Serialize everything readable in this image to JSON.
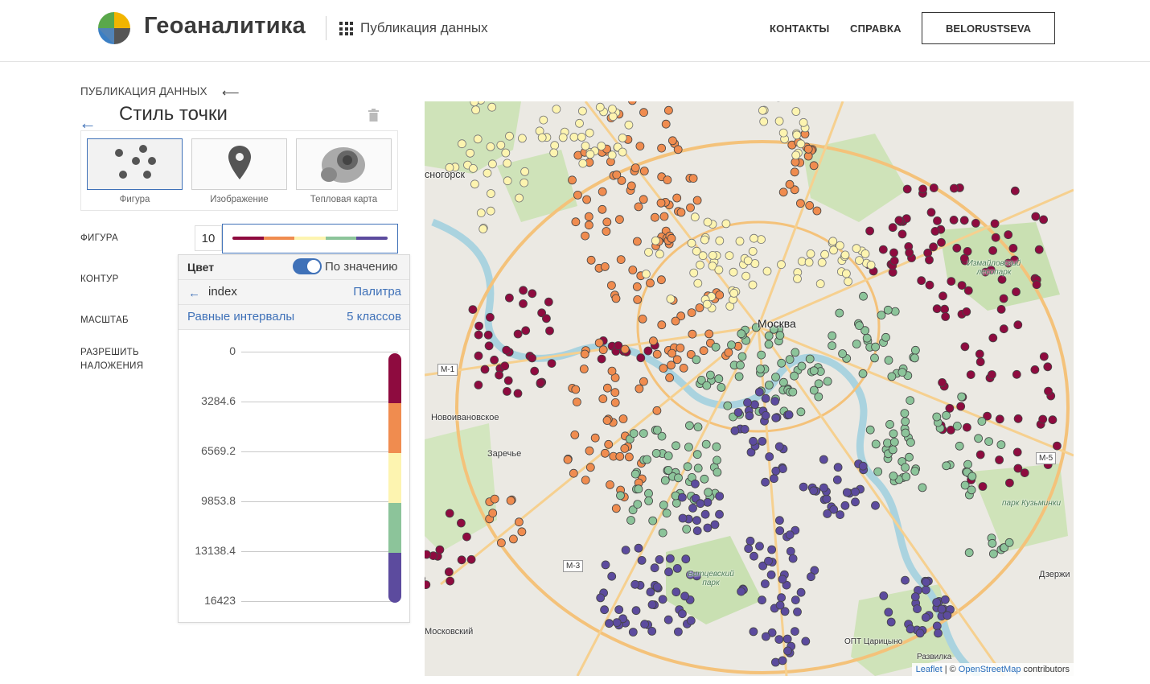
{
  "header": {
    "brand": "Геоаналитика",
    "section": "Публикация данных",
    "nav": [
      "КОНТАКТЫ",
      "СПРАВКА"
    ],
    "user": "BELORUSTSEVA"
  },
  "panel": {
    "breadcrumb": "ПУБЛИКАЦИЯ ДАННЫХ",
    "title": "Стиль точки",
    "types": [
      {
        "label": "Фигура",
        "icon": "scatter-dots-icon",
        "active": true
      },
      {
        "label": "Изображение",
        "icon": "map-pin-icon",
        "active": false
      },
      {
        "label": "Тепловая карта",
        "icon": "heatmap-icon",
        "active": false
      }
    ],
    "props": {
      "figure": "ФИГУРА",
      "contour": "КОНТУР",
      "scale": "МАСШТАБ",
      "overlap": "РАЗРЕШИТЬ НАЛОЖЕНИЯ"
    },
    "size_value": "10",
    "color": {
      "label": "Цвет",
      "by_value_label": "По значению",
      "by_value_on": true,
      "field": "index",
      "palette_link": "Палитра",
      "method": "Равные интервалы",
      "classes": "5 классов",
      "breaks": [
        "0",
        "3284.6",
        "6569.2",
        "9853.8",
        "13138.4",
        "16423"
      ],
      "colors": [
        "#8e0b3f",
        "#f08c4f",
        "#fdf4b0",
        "#8cc49a",
        "#5c4b9e"
      ]
    }
  },
  "map": {
    "labels": {
      "moscow": "Москва",
      "krasnogorsk": "сногорск",
      "novoivanovskoe": "Новоивановское",
      "zarechye": "Заречье",
      "moskovsky": "Московский",
      "izmailovsky": "Измайловский лесопарк",
      "bitsevsky": "Битцевский парк",
      "kuzminki": "парк Кузьминки",
      "tsaritsyno": "ОПТ Царицыно",
      "razvilka": "Развилка",
      "dzerzhinsky": "Дзержи"
    },
    "road_shields": [
      "M-1",
      "M-3",
      "M-5"
    ],
    "attribution": {
      "leaflet": "Leaflet",
      "sep": "| ©",
      "osm": "OpenStreetMap",
      "tail": "contributors"
    }
  }
}
